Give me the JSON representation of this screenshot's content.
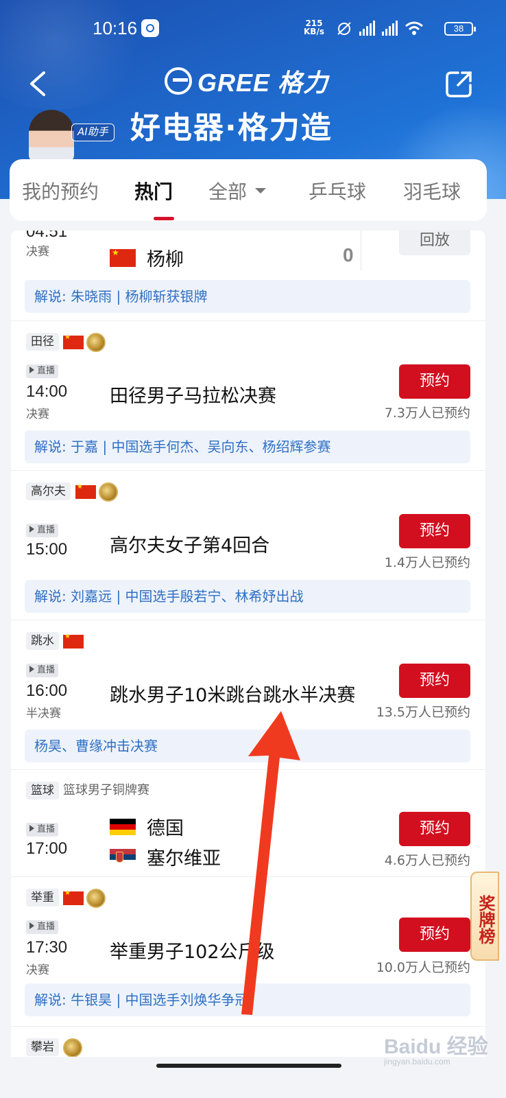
{
  "status_bar": {
    "time": "10:16",
    "net_speed_value": "215",
    "net_speed_unit": "KB/s",
    "battery": "38"
  },
  "header": {
    "brand": "GREE 格力",
    "slogan": "好电器·格力造",
    "ai_badge": "AI助手"
  },
  "tabs": [
    {
      "label": "我的预约",
      "active": false
    },
    {
      "label": "热门",
      "active": true
    },
    {
      "label": "全部",
      "active": false
    },
    {
      "label": "乒乓球",
      "active": false
    },
    {
      "label": "羽毛球",
      "active": false
    }
  ],
  "partial_card": {
    "time": "04:51",
    "stage": "决赛",
    "player": "杨柳",
    "score": "0",
    "button": "回放",
    "comment": "解说: 朱晓雨 | 杨柳斩获银牌"
  },
  "cards": [
    {
      "sport": "田径",
      "live": "直播",
      "time": "14:00",
      "stage": "决赛",
      "title": "田径男子马拉松决赛",
      "button": "预约",
      "count": "7.3万人已预约",
      "comment": "解说: 于嘉 | 中国选手何杰、吴向东、杨绍辉参赛"
    },
    {
      "sport": "高尔夫",
      "live": "直播",
      "time": "15:00",
      "title": "高尔夫女子第4回合",
      "button": "预约",
      "count": "1.4万人已预约",
      "comment": "解说: 刘嘉远 | 中国选手殷若宁、林希妤出战"
    },
    {
      "sport": "跳水",
      "live": "直播",
      "time": "16:00",
      "stage": "半决赛",
      "title": "跳水男子10米跳台跳水半决赛",
      "button": "预约",
      "count": "13.5万人已预约",
      "comment": "杨昊、曹缘冲击决赛"
    },
    {
      "sport": "篮球",
      "event": "篮球男子铜牌赛",
      "live": "直播",
      "time": "17:00",
      "team1": "德国",
      "team2": "塞尔维亚",
      "button": "预约",
      "count": "4.6万人已预约"
    },
    {
      "sport": "举重",
      "live": "直播",
      "time": "17:30",
      "stage": "决赛",
      "title": "举重男子102公斤级",
      "button": "预约",
      "count": "10.0万人已预约",
      "comment": "解说: 牛银昊 | 中国选手刘焕华争冠"
    },
    {
      "sport": "攀岩"
    }
  ],
  "medal_board": "奖牌榜",
  "watermark": {
    "main": "Baidu 经验",
    "sub": "jingyan.baidu.com"
  },
  "colors": {
    "accent_red": "#d20f1f",
    "header_blue": "#1f66c9",
    "comment_blue": "#2f6fc4"
  }
}
